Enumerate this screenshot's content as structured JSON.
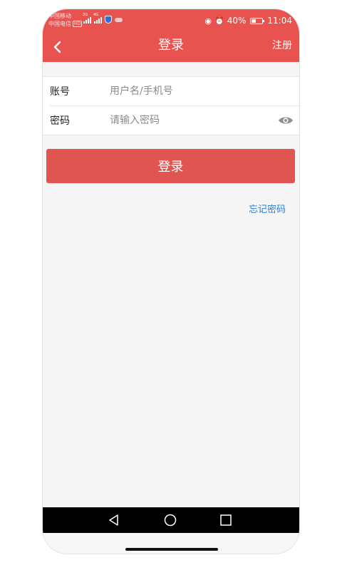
{
  "status_bar": {
    "carrier1": "中国移动",
    "carrier2": "中国电信",
    "hd_badge": "HD",
    "net1": "2G",
    "net2": "4G",
    "battery_percent": "40%",
    "battery_level": 0.4,
    "time": "11:04",
    "icons": [
      "signal-icon",
      "shield-icon",
      "cloud-icon",
      "eye-icon",
      "alarm-icon",
      "battery-icon"
    ]
  },
  "navbar": {
    "back_icon": "chevron-left-icon",
    "title": "登录",
    "right_action": "注册"
  },
  "form": {
    "account_label": "账号",
    "account_placeholder": "用户名/手机号",
    "account_value": "",
    "password_label": "密码",
    "password_placeholder": "请输入密码",
    "password_value": "",
    "password_toggle_icon": "eye-icon"
  },
  "login_button": "登录",
  "forgot_password": "忘记密码",
  "system_nav": {
    "icons": [
      "back-triangle-icon",
      "home-circle-icon",
      "recents-square-icon"
    ]
  },
  "colors": {
    "primary": "#e85350",
    "button": "#e05451",
    "link": "#2f7fd0",
    "background": "#f5f5f5"
  }
}
